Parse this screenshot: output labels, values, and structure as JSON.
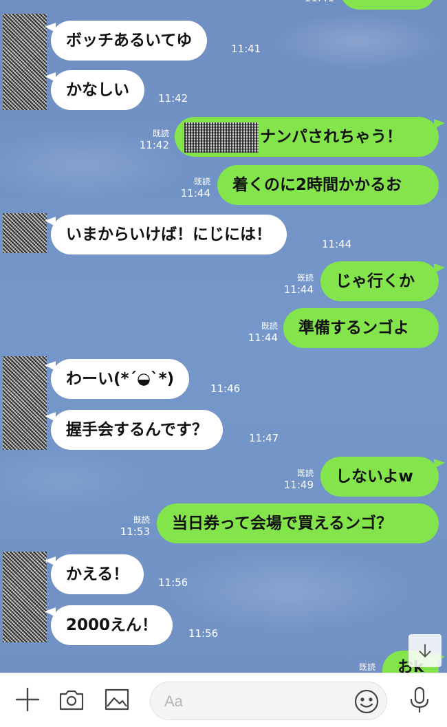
{
  "messages": {
    "m0": {
      "text": "ボッチあるいてゆ",
      "time": "11:41"
    },
    "m1": {
      "text": "かなしい",
      "time": "11:42"
    },
    "m2": {
      "text": "ナンパされちゃう！",
      "read": "既読",
      "time": "11:42"
    },
    "m3": {
      "text": "着くのに2時間かかるお",
      "read": "既読",
      "time": "11:44"
    },
    "m4": {
      "text": "いまからいけば！にじには！",
      "time": "11:44"
    },
    "m5": {
      "text": "じゃ行くか",
      "read": "既読",
      "time": "11:44"
    },
    "m6": {
      "text": "準備するンゴよ",
      "read": "既読",
      "time": "11:44"
    },
    "m7": {
      "text": "わーい(*´◒`*)",
      "time": "11:46"
    },
    "m8": {
      "text": "握手会するんです？",
      "time": "11:47"
    },
    "m9": {
      "text": "しないよw",
      "read": "既読",
      "time": "11:49"
    },
    "m10": {
      "text": "当日券って会場で買えるンゴ？",
      "read": "既読",
      "time": "11:53"
    },
    "m11": {
      "text": "かえる！",
      "time": "11:56"
    },
    "m12": {
      "text": "2000えん！",
      "time": "11:56"
    },
    "m13": {
      "text": "おk",
      "read": "既読"
    }
  },
  "input": {
    "placeholder": "Aa"
  },
  "icons": [
    "plus-icon",
    "camera-icon",
    "image-icon",
    "emoji-icon",
    "microphone-icon",
    "arrow-down-icon"
  ],
  "colors": {
    "chat_bg": "#7493c4",
    "outgoing": "#83e54b",
    "incoming": "#ffffff"
  }
}
